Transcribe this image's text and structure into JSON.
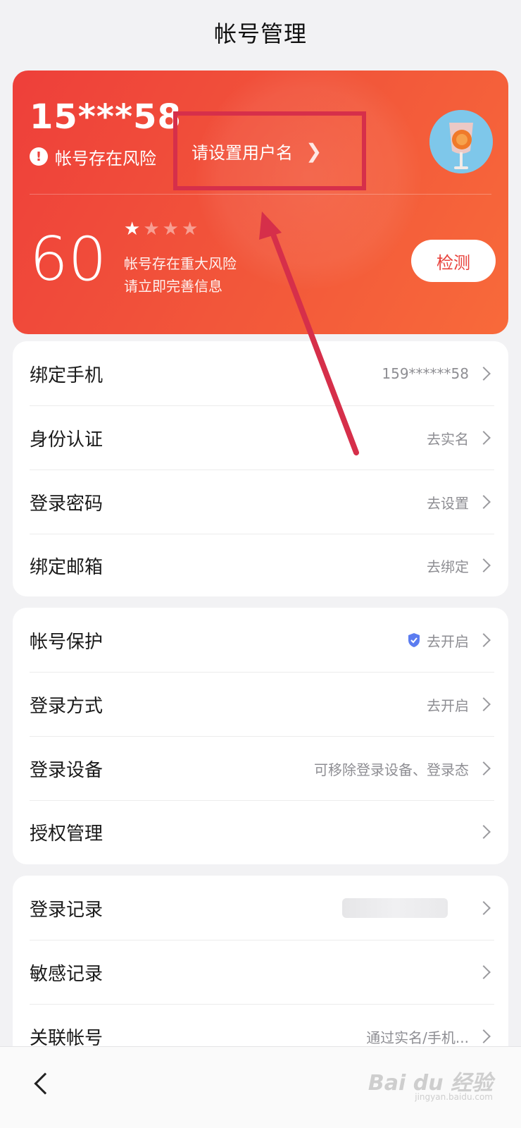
{
  "header": {
    "title": "帐号管理"
  },
  "account_card": {
    "account_id": "15***58",
    "risk_text": "帐号存在风险",
    "set_username_label": "请设置用户名",
    "score": "60",
    "stars_filled": 1,
    "stars_total": 4,
    "risk_desc_line1": "帐号存在重大风险",
    "risk_desc_line2": "请立即完善信息",
    "detect_button": "检测",
    "colors": {
      "card_start": "#ee3f3a",
      "card_end": "#f86a3a",
      "annotation": "#d62f4a"
    }
  },
  "groups": [
    {
      "items": [
        {
          "label": "绑定手机",
          "value": "159******58"
        },
        {
          "label": "身份认证",
          "value": "去实名"
        },
        {
          "label": "登录密码",
          "value": "去设置"
        },
        {
          "label": "绑定邮箱",
          "value": "去绑定"
        }
      ]
    },
    {
      "items": [
        {
          "label": "帐号保护",
          "value": "去开启",
          "icon": "shield-check-icon"
        },
        {
          "label": "登录方式",
          "value": "去开启"
        },
        {
          "label": "登录设备",
          "value": "可移除登录设备、登录态"
        },
        {
          "label": "授权管理",
          "value": ""
        }
      ]
    },
    {
      "items": [
        {
          "label": "登录记录",
          "value": ""
        },
        {
          "label": "敏感记录",
          "value": ""
        },
        {
          "label": "关联帐号",
          "value": "通过实名/手机..."
        }
      ]
    }
  ],
  "watermark": {
    "text": "Bai du 经验",
    "sub": "jingyan.baidu.com"
  }
}
